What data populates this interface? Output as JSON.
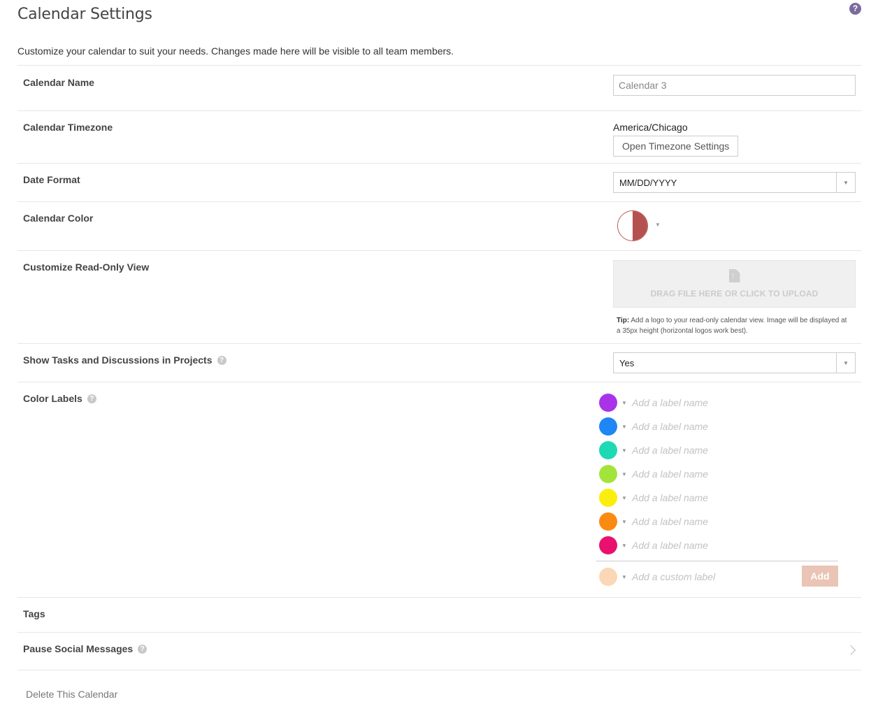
{
  "header": {
    "title": "Calendar Settings",
    "help_icon": "help-icon"
  },
  "intro": "Customize your calendar to suit your needs. Changes made here will be visible to all team members.",
  "calendar_name": {
    "label": "Calendar Name",
    "value": "Calendar 3"
  },
  "timezone": {
    "label": "Calendar Timezone",
    "value": "America/Chicago",
    "button": "Open Timezone Settings"
  },
  "date_format": {
    "label": "Date Format",
    "selected": "MM/DD/YYYY"
  },
  "calendar_color": {
    "label": "Calendar Color",
    "color": "#b5514f"
  },
  "read_only": {
    "label": "Customize Read-Only View",
    "upload_text": "DRAG FILE HERE OR CLICK TO UPLOAD",
    "tip_bold": "Tip:",
    "tip_text": "Add a logo to your read-only calendar view. Image will be displayed at a 35px height (horizontal logos work best)."
  },
  "tasks": {
    "label": "Show Tasks and Discussions in Projects",
    "selected": "Yes"
  },
  "color_labels": {
    "label": "Color Labels",
    "items": [
      {
        "color": "#a933e8",
        "placeholder": "Add a label name"
      },
      {
        "color": "#1e86f5",
        "placeholder": "Add a label name"
      },
      {
        "color": "#1ed9b6",
        "placeholder": "Add a label name"
      },
      {
        "color": "#a3e43a",
        "placeholder": "Add a label name"
      },
      {
        "color": "#fbee0e",
        "placeholder": "Add a label name"
      },
      {
        "color": "#fb8a10",
        "placeholder": "Add a label name"
      },
      {
        "color": "#e8126e",
        "placeholder": "Add a label name"
      }
    ],
    "custom": {
      "color": "#fbd7b5",
      "placeholder": "Add a custom label",
      "button": "Add"
    }
  },
  "tags": {
    "label": "Tags"
  },
  "pause_social": {
    "label": "Pause Social Messages"
  },
  "delete_link": "Delete This Calendar"
}
